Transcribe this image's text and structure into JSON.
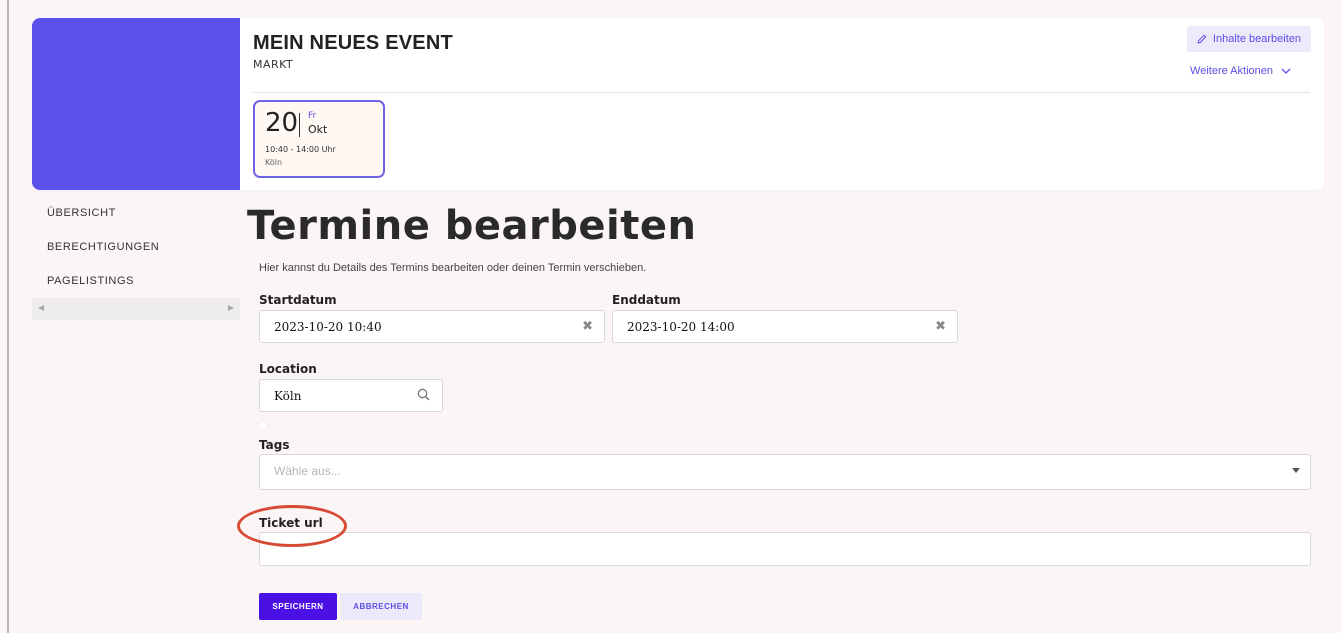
{
  "header": {
    "title": "MEIN NEUES EVENT",
    "subtitle": "MARKT",
    "edit_label": "Inhalte bearbeiten",
    "more_actions_label": "Weitere Aktionen",
    "cover_color": "#5b52ee"
  },
  "date_tile": {
    "day": "20",
    "weekday": "Fr",
    "month": "Okt",
    "time": "10:40 - 14:00 Uhr",
    "location": "Köln"
  },
  "sidebar": {
    "items": [
      {
        "label": "ÜBERSICHT"
      },
      {
        "label": "BERECHTIGUNGEN"
      },
      {
        "label": "PAGELISTINGS"
      }
    ]
  },
  "main": {
    "heading": "Termine bearbeiten",
    "description": "Hier kannst du Details des Termins bearbeiten oder deinen Termin verschieben.",
    "start": {
      "label": "Startdatum",
      "value": "2023-10-20 10:40"
    },
    "end": {
      "label": "Enddatum",
      "value": "2023-10-20 14:00"
    },
    "location": {
      "label": "Location",
      "value": "Köln"
    },
    "tags": {
      "label": "Tags",
      "placeholder": "Wähle aus..."
    },
    "ticket": {
      "label": "Ticket url",
      "value": ""
    },
    "save_label": "SPEICHERN",
    "cancel_label": "ABBRECHEN"
  },
  "colors": {
    "accent": "#5a4ee6",
    "primary_button": "#4b10e3",
    "annotation": "#d74a34"
  }
}
